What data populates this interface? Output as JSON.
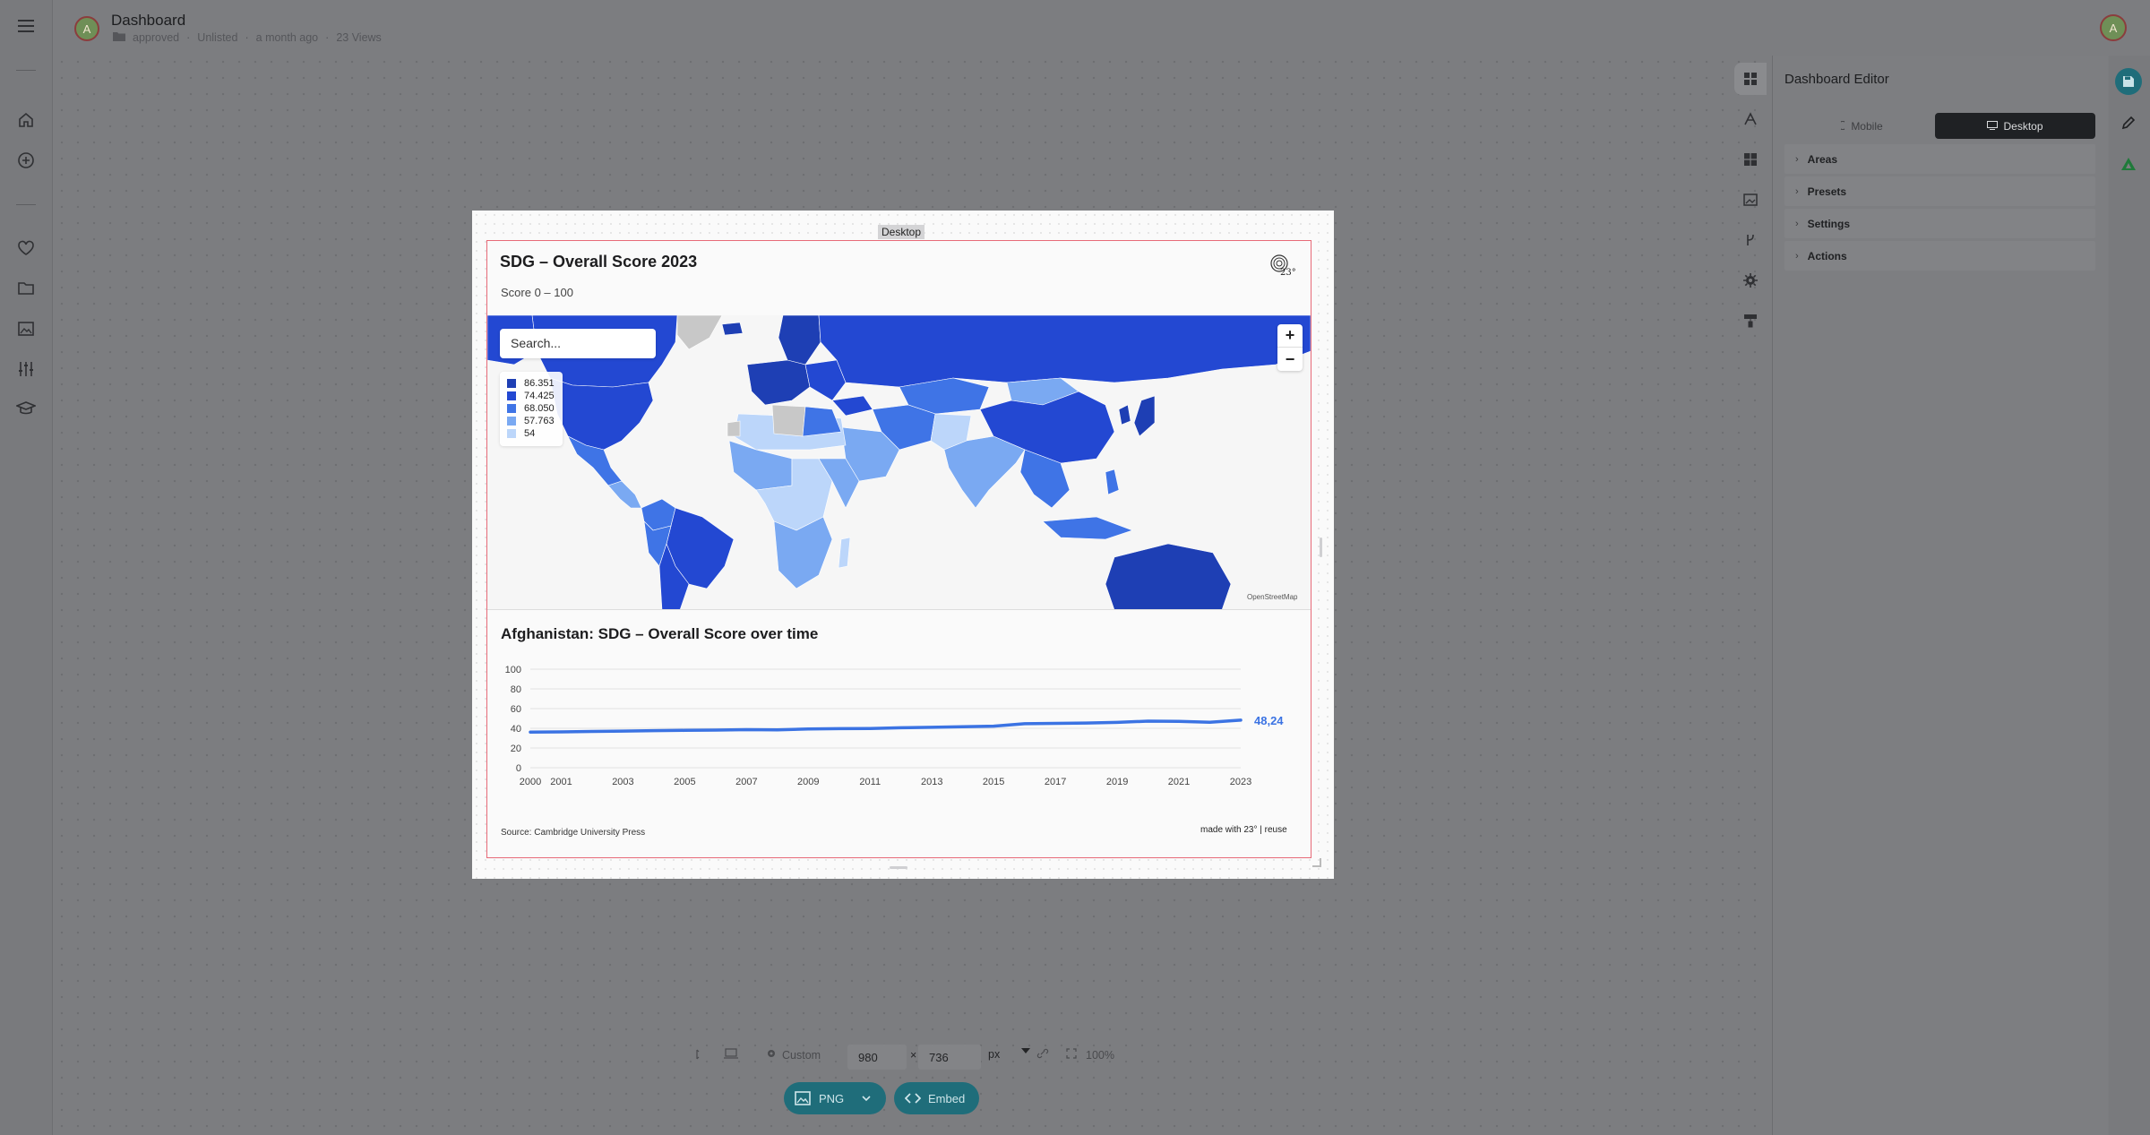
{
  "header": {
    "avatar_initial": "A",
    "title": "Dashboard",
    "status": "approved",
    "visibility": "Unlisted",
    "updated": "a month ago",
    "views": "23 Views",
    "user_initial": "A"
  },
  "frame": {
    "label": "Desktop"
  },
  "map_widget": {
    "title": "SDG – Overall Score 2023",
    "subtitle": "Score 0 – 100",
    "search_placeholder": "Search...",
    "legend": [
      {
        "label": "86.351",
        "color": "#1e3fb4"
      },
      {
        "label": "74.425",
        "color": "#2348d2"
      },
      {
        "label": "68.050",
        "color": "#3f74e6"
      },
      {
        "label": "57.763",
        "color": "#7aa9f2"
      },
      {
        "label": "54",
        "color": "#bcd6fa"
      }
    ],
    "zoom_in": "+",
    "zoom_out": "−",
    "attribution": "OpenStreetMap"
  },
  "line_widget": {
    "title": "Afghanistan: SDG – Overall Score over time",
    "source": "Source: Cambridge University Press",
    "made_with": "made with 23° | reuse"
  },
  "chart_data": {
    "type": "line",
    "title": "Afghanistan: SDG – Overall Score over time",
    "x": [
      2000,
      2001,
      2002,
      2003,
      2004,
      2005,
      2006,
      2007,
      2008,
      2009,
      2010,
      2011,
      2012,
      2013,
      2014,
      2015,
      2016,
      2017,
      2018,
      2019,
      2020,
      2021,
      2022,
      2023
    ],
    "x_ticks": [
      "2000",
      "2001",
      "2003",
      "2005",
      "2007",
      "2009",
      "2011",
      "2013",
      "2015",
      "2017",
      "2019",
      "2021",
      "2023"
    ],
    "series": [
      {
        "values": [
          36.2,
          36.4,
          36.8,
          37.2,
          37.6,
          37.9,
          38.2,
          38.6,
          38.4,
          39.4,
          39.6,
          39.8,
          40.5,
          41.0,
          41.5,
          42.2,
          44.6,
          45.0,
          45.4,
          46.0,
          47.3,
          47.0,
          46.2,
          48.24
        ],
        "color": "#3b73e3"
      }
    ],
    "last_value_label": "48,24",
    "ylim": [
      0,
      100
    ],
    "y_ticks": [
      "0",
      "20",
      "40",
      "60",
      "80",
      "100"
    ],
    "grid": true
  },
  "tools": [
    "dashboard-icon",
    "text-icon",
    "widgets-icon",
    "image-icon",
    "branch-icon",
    "gear-icon",
    "paint-icon"
  ],
  "editor": {
    "title": "Dashboard Editor",
    "mobile_label": "Mobile",
    "desktop_label": "Desktop",
    "sections": [
      "Areas",
      "Presets",
      "Settings",
      "Actions"
    ]
  },
  "bottom_bar": {
    "preset": "Custom",
    "width": "980",
    "times": "×",
    "height": "736",
    "unit": "px",
    "zoom": "100%",
    "png_label": "PNG",
    "embed_label": "Embed"
  },
  "colors": {
    "accent": "#1f6d7a",
    "frame_border": "#e76a78",
    "map_dark": "#1e3fb4",
    "map_mid": "#2348d2",
    "map_light": "#7aa9f2"
  }
}
